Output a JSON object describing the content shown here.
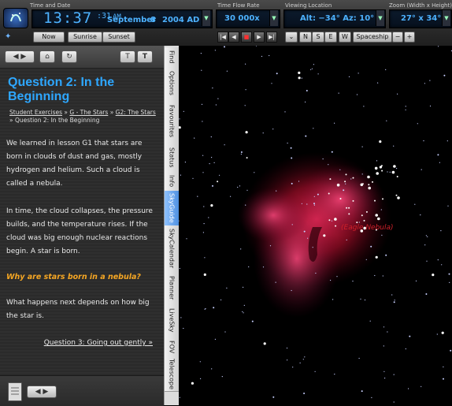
{
  "toolbar": {
    "time_date_label": "Time and Date",
    "time_display": "13:37",
    "seconds_display": ":31",
    "am_pm": "AM",
    "month": "September",
    "day": "8",
    "year": "2004 AD",
    "time_flow_label": "Time Flow Rate",
    "time_flow_value": "30 000x",
    "viewing_location_label": "Viewing Location",
    "viewing_location_value": "Alt: −34°  Az: 10°",
    "zoom_label": "Zoom (Width x Height)",
    "zoom_value": "27° x 34°",
    "now_label": "Now",
    "sunrise_label": "Sunrise",
    "sunset_label": "Sunset",
    "dir_n": "N",
    "dir_s": "S",
    "dir_e": "E",
    "dir_w": "W",
    "spaceship_label": "Spaceship",
    "zoom_minus": "−",
    "zoom_plus": "+"
  },
  "panel": {
    "title": "Question 2: In the Beginning",
    "breadcrumb": {
      "item1": "Student Exercises",
      "sep": " » ",
      "item2": "G - The Stars",
      "item3": "G2: The Stars",
      "item4": "Question 2: In the Beginning"
    },
    "paragraph1": "We learned in lesson G1 that stars are born in clouds of dust and gas, mostly hydrogen and helium. Such a cloud is called a nebula.",
    "paragraph2": "In time, the cloud collapses, the pressure builds, and the temperature rises. If the cloud was big enough nuclear reactions begin. A star is born.",
    "highlight": "Why are stars born in a nebula?",
    "paragraph3": "What happens next depends on how big the star is.",
    "next_link": "Question 3: Going out gently »"
  },
  "tabs": [
    "Find",
    "Options",
    "Favourites",
    "Status",
    "Info",
    "SkyGuide",
    "SkyCalendar",
    "Planner",
    "LiveSky",
    "FOV",
    "Telescope"
  ],
  "active_tab": "SkyGuide",
  "sky": {
    "object_label": "(Eagle Nebula)"
  },
  "colors": {
    "title_blue": "#2ea7ff",
    "highlight_orange": "#f5a623",
    "nebula_red": "#d0202a"
  }
}
